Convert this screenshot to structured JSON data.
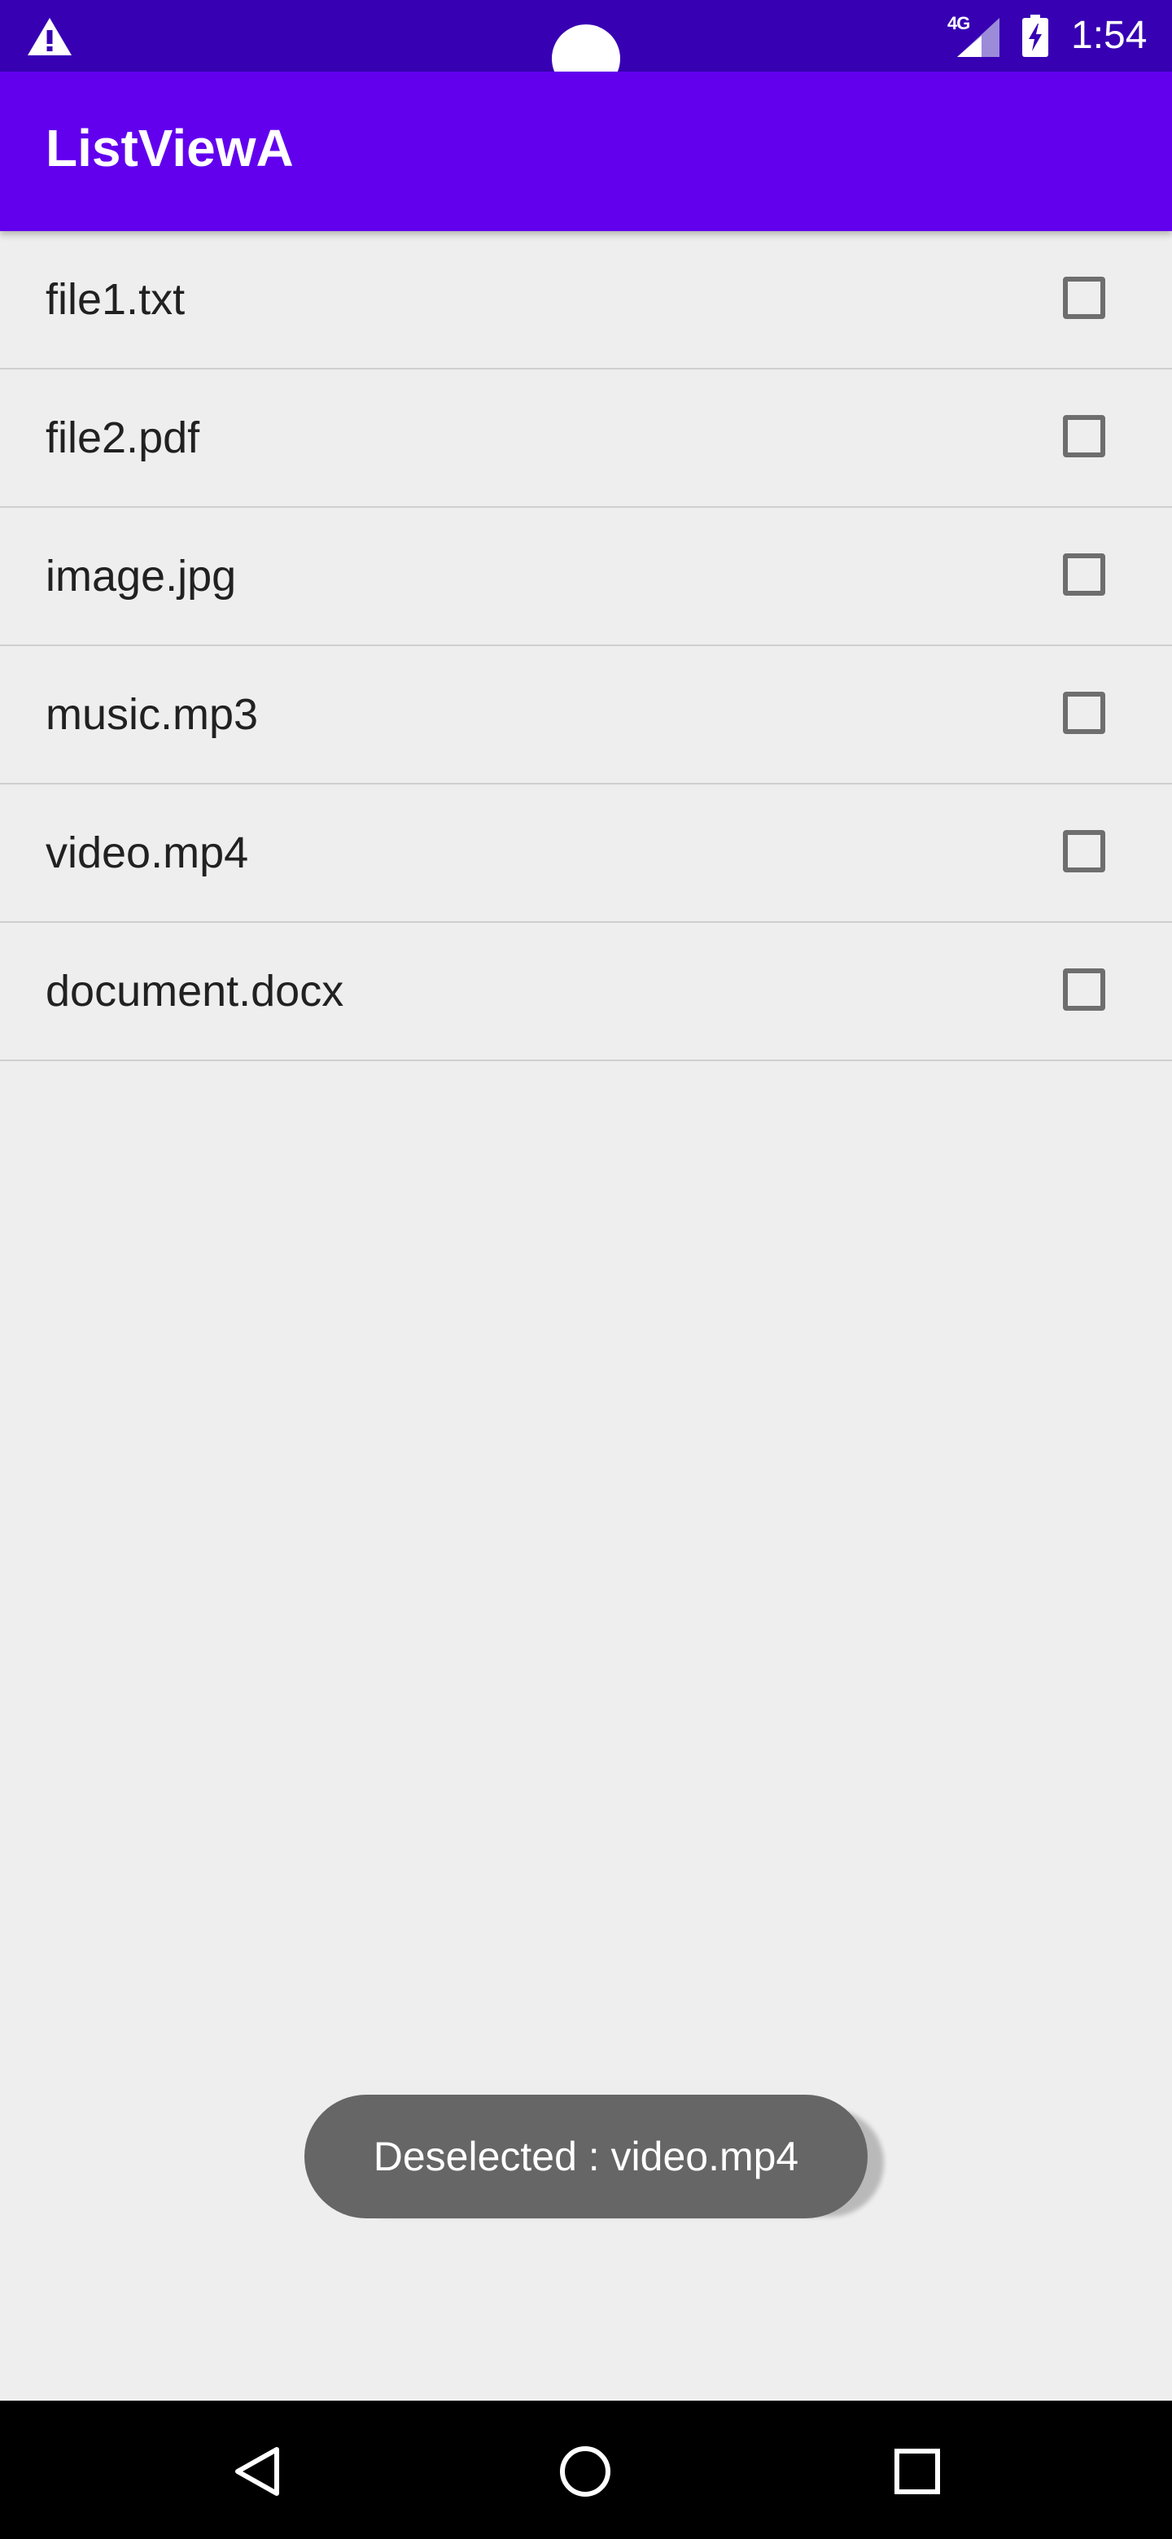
{
  "status_bar": {
    "network_type": "4G",
    "time": "1:54",
    "background_color": "#3700B3",
    "icons": [
      "warning-icon",
      "signal-icon",
      "battery-charging-icon"
    ]
  },
  "app_bar": {
    "title": "ListViewA",
    "background_color": "#6200EE"
  },
  "list": {
    "items": [
      {
        "label": "file1.txt",
        "checked": false
      },
      {
        "label": "file2.pdf",
        "checked": false
      },
      {
        "label": "image.jpg",
        "checked": false
      },
      {
        "label": "music.mp3",
        "checked": false
      },
      {
        "label": "video.mp4",
        "checked": false
      },
      {
        "label": "document.docx",
        "checked": false
      }
    ]
  },
  "toast": {
    "message": "Deselected : video.mp4"
  },
  "nav_bar": {
    "icons": [
      "back-icon",
      "home-icon",
      "recents-icon"
    ]
  }
}
